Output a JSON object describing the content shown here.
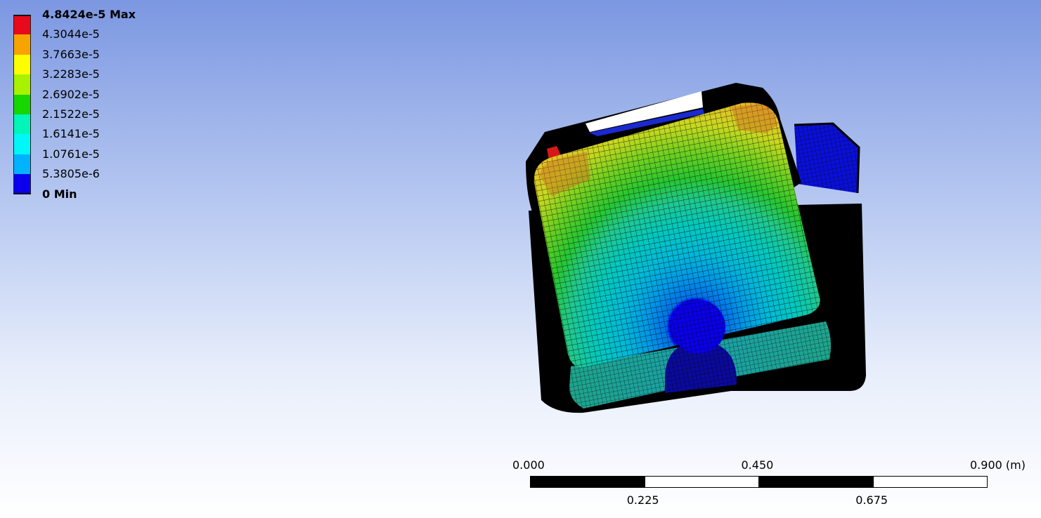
{
  "legend": {
    "entries": [
      {
        "label": "4.8424e-5 Max",
        "color": "#e8091b",
        "bold": true
      },
      {
        "label": "4.3044e-5",
        "color": "#f7a400",
        "bold": false
      },
      {
        "label": "3.7663e-5",
        "color": "#ffff00",
        "bold": false
      },
      {
        "label": "3.2283e-5",
        "color": "#a8f200",
        "bold": false
      },
      {
        "label": "2.6902e-5",
        "color": "#17d600",
        "bold": false
      },
      {
        "label": "2.1522e-5",
        "color": "#00f5b8",
        "bold": false
      },
      {
        "label": "1.6141e-5",
        "color": "#00f7f7",
        "bold": false
      },
      {
        "label": "1.0761e-5",
        "color": "#00b2ff",
        "bold": false
      },
      {
        "label": "5.3805e-6",
        "color": "#0a00ee",
        "bold": false
      },
      {
        "label": "0 Min",
        "color": null,
        "bold": true
      }
    ]
  },
  "scale_bar": {
    "top_labels": [
      "0.000",
      "0.450",
      "0.900 (m)"
    ],
    "bottom_labels": [
      "0.225",
      "0.675"
    ]
  },
  "model": {
    "name": "deformation-contour-plot",
    "edge_color": "#000000"
  }
}
